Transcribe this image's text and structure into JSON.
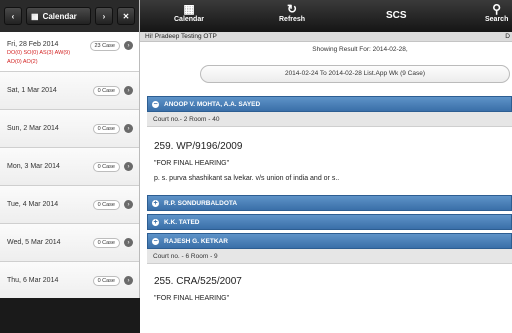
{
  "left": {
    "calendar_label": "Calendar",
    "days": [
      {
        "label": "Fri, 28 Feb 2014",
        "badge": "23 Case",
        "detail_line1": "DO(0) SO(0) AS(3) AW(9)",
        "detail_line2": "AO(0) AO(2)"
      },
      {
        "label": "Sat, 1 Mar 2014",
        "badge": "0 Case"
      },
      {
        "label": "Sun, 2 Mar 2014",
        "badge": "0 Case"
      },
      {
        "label": "Mon, 3 Mar 2014",
        "badge": "0 Case"
      },
      {
        "label": "Tue, 4 Mar 2014",
        "badge": "0 Case"
      },
      {
        "label": "Wed, 5 Mar 2014",
        "badge": "0 Case"
      },
      {
        "label": "Thu, 6 Mar 2014",
        "badge": "0 Case"
      }
    ]
  },
  "topbar": {
    "calendar_label": "Calendar",
    "refresh_label": "Refresh",
    "title": "SCS",
    "search_label": "Search"
  },
  "greeting": {
    "text": "Hi! Pradeep Testing OTP",
    "right": "D"
  },
  "showing": "Showing Result For: 2014-02-28,",
  "range": "2014-02-24 To 2014-02-28 List.App Wk (9 Case)",
  "groups": [
    {
      "toggle": "−",
      "name": "ANOOP V. MOHTA, A.A. SAYED",
      "court": "Court no.- 2 Room - 40",
      "case_no": "259. WP/9196/2009",
      "stage": "\"FOR FINAL HEARING\"",
      "parties": "p. s. purva shashikant sa lvekar. v/s union of india and or s.."
    },
    {
      "toggle": "+",
      "name": "R.P. SONDURBALDOTA"
    },
    {
      "toggle": "+",
      "name": "K.K. TATED"
    },
    {
      "toggle": "−",
      "name": "RAJESH G. KETKAR",
      "court": "Court no. - 6 Room - 9",
      "case_no": "255. CRA/525/2007",
      "stage": "\"FOR FINAL HEARING\""
    }
  ],
  "colors": {
    "header_blue": "#3a6fa8",
    "alert_red": "#d32222",
    "topbar_dark": "#151515"
  }
}
